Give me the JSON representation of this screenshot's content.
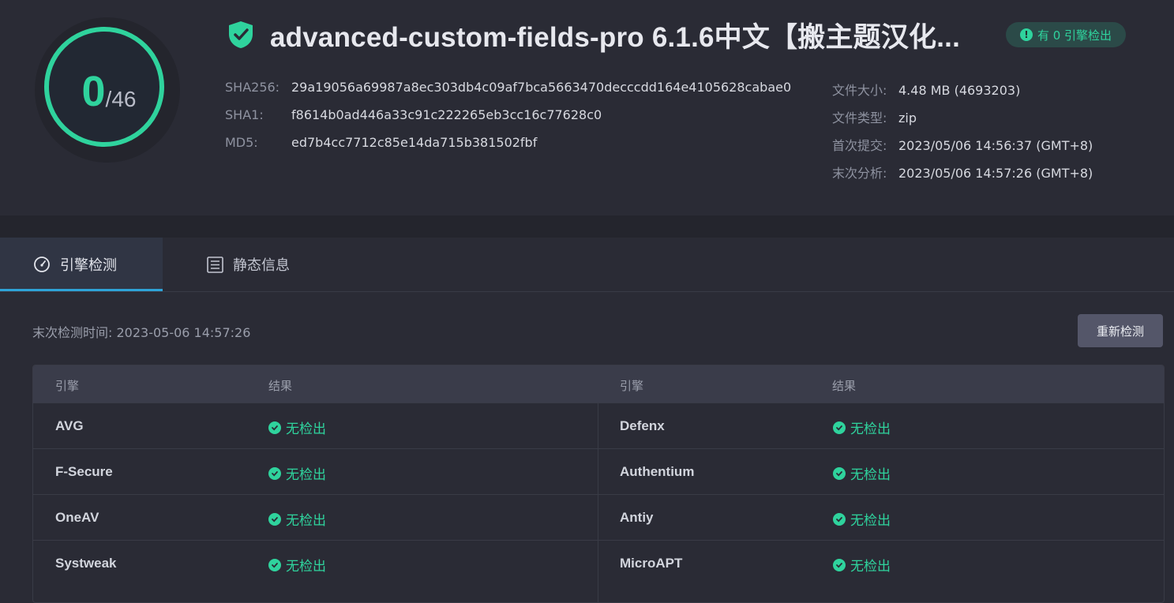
{
  "score": {
    "detected": "0",
    "total": "/46"
  },
  "file": {
    "title": "advanced-custom-fields-pro 6.1.6中文【搬主题汉化...",
    "badge": "有 0 引擎检出",
    "hashes": [
      {
        "label": "SHA256:",
        "value": "29a19056a69987a8ec303db4c09af7bca5663470decccdd164e4105628cabae0"
      },
      {
        "label": "SHA1:",
        "value": "f8614b0ad446a33c91c222265eb3cc16c77628c0"
      },
      {
        "label": "MD5:",
        "value": "ed7b4cc7712c85e14da715b381502fbf"
      }
    ],
    "meta": [
      {
        "label": "文件大小:",
        "value": "4.48 MB (4693203)"
      },
      {
        "label": "文件类型:",
        "value": "zip"
      },
      {
        "label": "首次提交:",
        "value": "2023/05/06 14:56:37 (GMT+8)"
      },
      {
        "label": "末次分析:",
        "value": "2023/05/06 14:57:26 (GMT+8)"
      }
    ]
  },
  "tabs": [
    {
      "label": "引擎检测",
      "icon": "gauge-icon",
      "active": true
    },
    {
      "label": "静态信息",
      "icon": "list-icon",
      "active": false
    }
  ],
  "detection": {
    "last_check": "末次检测时间: 2023-05-06 14:57:26",
    "recheck_label": "重新检测",
    "headers": {
      "engine": "引擎",
      "result": "结果"
    },
    "rows": [
      {
        "left": {
          "engine": "AVG",
          "result": "无检出"
        },
        "right": {
          "engine": "Defenx",
          "result": "无检出"
        }
      },
      {
        "left": {
          "engine": "F-Secure",
          "result": "无检出"
        },
        "right": {
          "engine": "Authentium",
          "result": "无检出"
        }
      },
      {
        "left": {
          "engine": "OneAV",
          "result": "无检出"
        },
        "right": {
          "engine": "Antiy",
          "result": "无检出"
        }
      },
      {
        "left": {
          "engine": "Systweak",
          "result": "无检出"
        },
        "right": {
          "engine": "MicroAPT",
          "result": "无检出"
        }
      }
    ]
  },
  "colors": {
    "accent": "#2fd39d",
    "tab_underline": "#2ea3d8",
    "background": "#2a2b35"
  }
}
